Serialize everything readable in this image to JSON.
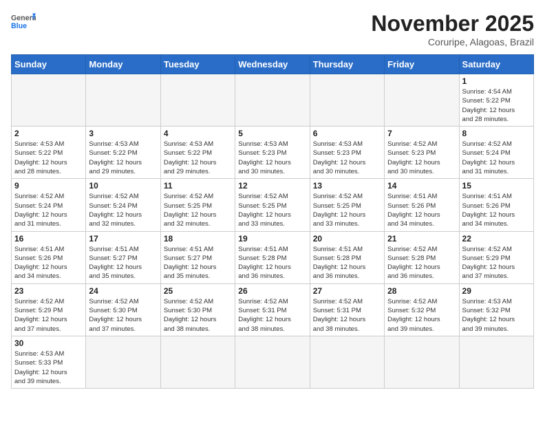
{
  "header": {
    "logo_general": "General",
    "logo_blue": "Blue",
    "month_title": "November 2025",
    "subtitle": "Coruripe, Alagoas, Brazil"
  },
  "weekdays": [
    "Sunday",
    "Monday",
    "Tuesday",
    "Wednesday",
    "Thursday",
    "Friday",
    "Saturday"
  ],
  "weeks": [
    [
      {
        "day": null,
        "info": ""
      },
      {
        "day": null,
        "info": ""
      },
      {
        "day": null,
        "info": ""
      },
      {
        "day": null,
        "info": ""
      },
      {
        "day": null,
        "info": ""
      },
      {
        "day": null,
        "info": ""
      },
      {
        "day": "1",
        "info": "Sunrise: 4:54 AM\nSunset: 5:22 PM\nDaylight: 12 hours\nand 28 minutes."
      }
    ],
    [
      {
        "day": "2",
        "info": "Sunrise: 4:53 AM\nSunset: 5:22 PM\nDaylight: 12 hours\nand 28 minutes."
      },
      {
        "day": "3",
        "info": "Sunrise: 4:53 AM\nSunset: 5:22 PM\nDaylight: 12 hours\nand 29 minutes."
      },
      {
        "day": "4",
        "info": "Sunrise: 4:53 AM\nSunset: 5:22 PM\nDaylight: 12 hours\nand 29 minutes."
      },
      {
        "day": "5",
        "info": "Sunrise: 4:53 AM\nSunset: 5:23 PM\nDaylight: 12 hours\nand 30 minutes."
      },
      {
        "day": "6",
        "info": "Sunrise: 4:53 AM\nSunset: 5:23 PM\nDaylight: 12 hours\nand 30 minutes."
      },
      {
        "day": "7",
        "info": "Sunrise: 4:52 AM\nSunset: 5:23 PM\nDaylight: 12 hours\nand 30 minutes."
      },
      {
        "day": "8",
        "info": "Sunrise: 4:52 AM\nSunset: 5:24 PM\nDaylight: 12 hours\nand 31 minutes."
      }
    ],
    [
      {
        "day": "9",
        "info": "Sunrise: 4:52 AM\nSunset: 5:24 PM\nDaylight: 12 hours\nand 31 minutes."
      },
      {
        "day": "10",
        "info": "Sunrise: 4:52 AM\nSunset: 5:24 PM\nDaylight: 12 hours\nand 32 minutes."
      },
      {
        "day": "11",
        "info": "Sunrise: 4:52 AM\nSunset: 5:25 PM\nDaylight: 12 hours\nand 32 minutes."
      },
      {
        "day": "12",
        "info": "Sunrise: 4:52 AM\nSunset: 5:25 PM\nDaylight: 12 hours\nand 33 minutes."
      },
      {
        "day": "13",
        "info": "Sunrise: 4:52 AM\nSunset: 5:25 PM\nDaylight: 12 hours\nand 33 minutes."
      },
      {
        "day": "14",
        "info": "Sunrise: 4:51 AM\nSunset: 5:26 PM\nDaylight: 12 hours\nand 34 minutes."
      },
      {
        "day": "15",
        "info": "Sunrise: 4:51 AM\nSunset: 5:26 PM\nDaylight: 12 hours\nand 34 minutes."
      }
    ],
    [
      {
        "day": "16",
        "info": "Sunrise: 4:51 AM\nSunset: 5:26 PM\nDaylight: 12 hours\nand 34 minutes."
      },
      {
        "day": "17",
        "info": "Sunrise: 4:51 AM\nSunset: 5:27 PM\nDaylight: 12 hours\nand 35 minutes."
      },
      {
        "day": "18",
        "info": "Sunrise: 4:51 AM\nSunset: 5:27 PM\nDaylight: 12 hours\nand 35 minutes."
      },
      {
        "day": "19",
        "info": "Sunrise: 4:51 AM\nSunset: 5:28 PM\nDaylight: 12 hours\nand 36 minutes."
      },
      {
        "day": "20",
        "info": "Sunrise: 4:51 AM\nSunset: 5:28 PM\nDaylight: 12 hours\nand 36 minutes."
      },
      {
        "day": "21",
        "info": "Sunrise: 4:52 AM\nSunset: 5:28 PM\nDaylight: 12 hours\nand 36 minutes."
      },
      {
        "day": "22",
        "info": "Sunrise: 4:52 AM\nSunset: 5:29 PM\nDaylight: 12 hours\nand 37 minutes."
      }
    ],
    [
      {
        "day": "23",
        "info": "Sunrise: 4:52 AM\nSunset: 5:29 PM\nDaylight: 12 hours\nand 37 minutes."
      },
      {
        "day": "24",
        "info": "Sunrise: 4:52 AM\nSunset: 5:30 PM\nDaylight: 12 hours\nand 37 minutes."
      },
      {
        "day": "25",
        "info": "Sunrise: 4:52 AM\nSunset: 5:30 PM\nDaylight: 12 hours\nand 38 minutes."
      },
      {
        "day": "26",
        "info": "Sunrise: 4:52 AM\nSunset: 5:31 PM\nDaylight: 12 hours\nand 38 minutes."
      },
      {
        "day": "27",
        "info": "Sunrise: 4:52 AM\nSunset: 5:31 PM\nDaylight: 12 hours\nand 38 minutes."
      },
      {
        "day": "28",
        "info": "Sunrise: 4:52 AM\nSunset: 5:32 PM\nDaylight: 12 hours\nand 39 minutes."
      },
      {
        "day": "29",
        "info": "Sunrise: 4:53 AM\nSunset: 5:32 PM\nDaylight: 12 hours\nand 39 minutes."
      }
    ],
    [
      {
        "day": "30",
        "info": "Sunrise: 4:53 AM\nSunset: 5:33 PM\nDaylight: 12 hours\nand 39 minutes."
      },
      {
        "day": null,
        "info": ""
      },
      {
        "day": null,
        "info": ""
      },
      {
        "day": null,
        "info": ""
      },
      {
        "day": null,
        "info": ""
      },
      {
        "day": null,
        "info": ""
      },
      {
        "day": null,
        "info": ""
      }
    ]
  ]
}
